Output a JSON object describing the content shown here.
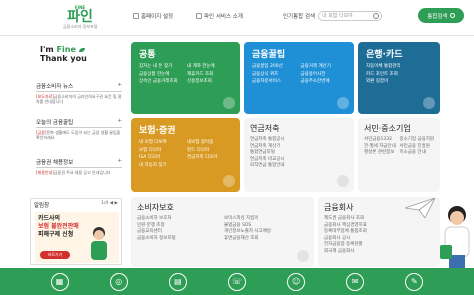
{
  "header": {
    "logo_top": "FINE",
    "logo_main": "파인",
    "logo_sub": "금융소비자 정보포털",
    "nav": [
      {
        "label": "홈페이지 설정"
      },
      {
        "label": "파인 서비스 소개"
      }
    ],
    "popular_label": "인기통합 검색",
    "search_placeholder": "내 보험 다보여",
    "integrated_search": "통합검색"
  },
  "welcome": {
    "line1a": "I'm ",
    "line1b": "Fine",
    "line2": "Thank you"
  },
  "left": {
    "news": {
      "title": "금융소비자 뉴스",
      "tag": "[보도자료]",
      "text": "금융소비자의 금리인하요구권 요건 및 절차를 안내합니다"
    },
    "today": {
      "title": "오늘의 금융꿀팁",
      "tag": "[금융]",
      "text": "문화 생활에도 도움이 되는 금융 생활 꿀팁을 확인하세요"
    },
    "recruit": {
      "title": "금융권 채용정보",
      "tag": "[채용안내]",
      "text": "금융권 주요 채용 공고 안내입니다"
    },
    "album": {
      "title": "알림창",
      "pager": "1/4",
      "banner_l1": "카드사의",
      "banner_l2": "보험 불완전판매",
      "banner_l3": "피해구제 신청",
      "banner_btn": "바로가기"
    }
  },
  "tiles": {
    "common": {
      "title": "공통",
      "items": [
        "잠자는 내 돈 찾기",
        "내 계좌 한눈에",
        "금융상품 한눈에",
        "제휴카드 조회",
        "상속인 금융거래조회",
        "신용정보조회"
      ]
    },
    "tips": {
      "title": "금융꿀팁",
      "items": [
        "금융꿀팁 200선",
        "금융거래 계산기",
        "금융상식 퀴즈",
        "금융용어사전",
        "금융자문서비스",
        "금융주소한번에"
      ]
    },
    "bank": {
      "title": "은행·카드",
      "items": [
        "자동이체 통합관리",
        "카드 포인트 조회",
        "외환 길잡이"
      ]
    },
    "insurance": {
      "title": "보험·증권",
      "items": [
        "내 보험 다보여",
        "내보험 찾아줌",
        "보험 다모아",
        "펀드 다모아",
        "ISA 다모아",
        "연금저축 다모아",
        "내 자동차 찾기"
      ]
    },
    "pension": {
      "title": "연금저축",
      "items": [
        "연금저축 통합공시",
        "연금저축 계산기",
        "통합연금포털",
        "연금저축 비교공시",
        "퇴직연금 통합안내"
      ]
    },
    "sme": {
      "title": "서민·중소기업",
      "items": [
        "서민금융1332",
        "중소기업 금융지원",
        "전·월세 자금안내",
        "서민금융 진흥원",
        "햇살론 관련정보",
        "미소금융 안내"
      ]
    },
    "consumer": {
      "title": "소비자보호",
      "items": [
        "금융소비자 보호처",
        "보이스피싱 지킴이",
        "민원·분쟁 조정",
        "불법금융 SOS",
        "금융교육센터",
        "개인정보노출자 사고예방",
        "금융소비자 정보포털",
        "휴면금융재산 조회"
      ]
    },
    "company": {
      "title": "금융회사",
      "items": [
        "제도권 금융회사 조회",
        "금융회사 핵심경영지표",
        "등록대부업체 통합조회",
        "금융회사 공시",
        "전자금융업 등록현황",
        "외국계 금융회사"
      ]
    }
  },
  "footer": {
    "icons": [
      "calc-icon",
      "coin-icon",
      "doc-icon",
      "phone-icon",
      "user-icon",
      "chat-icon",
      "mail-icon"
    ]
  }
}
